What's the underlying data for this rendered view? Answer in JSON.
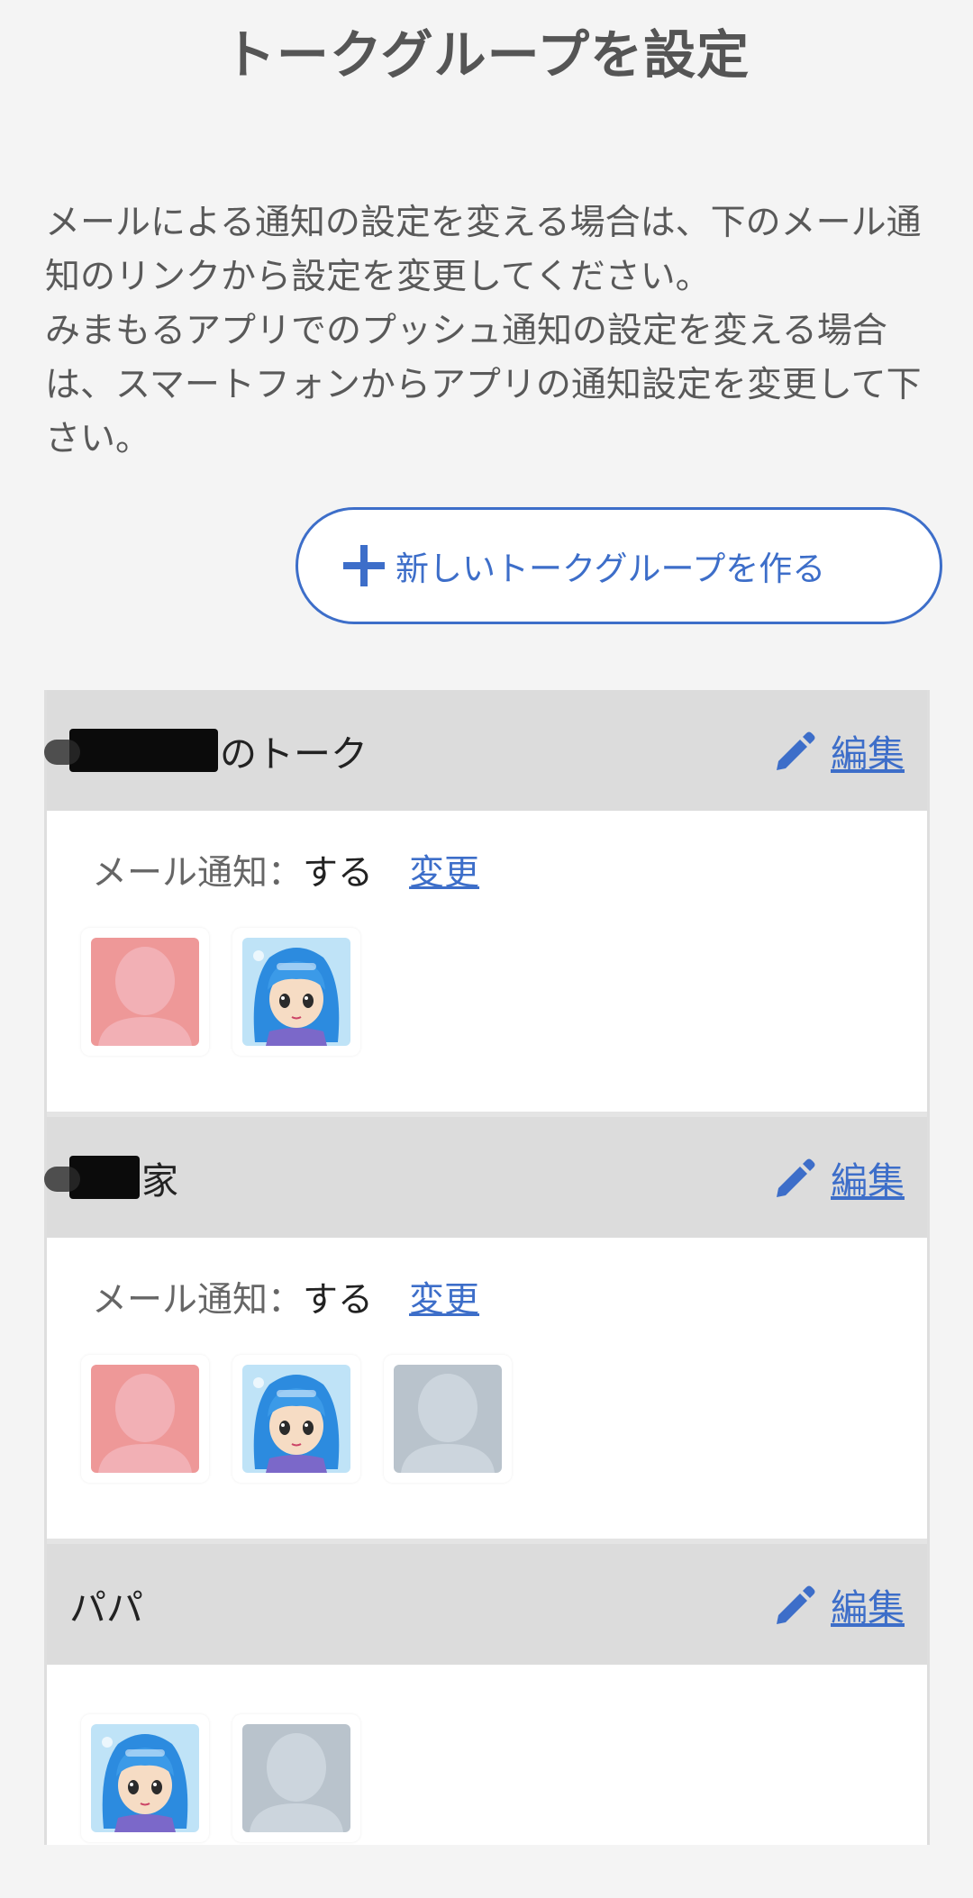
{
  "page": {
    "title": "トークグループを設定"
  },
  "notice": {
    "line1": "メールによる通知の設定を変える場合は、下のメール通知のリンクから設定を変更してください。",
    "line2": "みまもるアプリでのプッシュ通知の設定を変える場合は、スマートフォンからアプリの通知設定を変更して下さい。"
  },
  "new_group_button": {
    "label": "新しいトークグループを作る",
    "icon": "plus-icon"
  },
  "colors": {
    "accent": "#3d6ec9",
    "header_bg": "#dcdcdc",
    "avatar_pink": "#ee9898",
    "avatar_gray": "#b9c3cc"
  },
  "groups": [
    {
      "name_suffix": "のトーク",
      "edit_label": "編集",
      "notify_label": "メール通知：",
      "notify_value": "する",
      "change_label": "変更",
      "members": [
        "pink-default-avatar",
        "anime-girl-avatar"
      ]
    },
    {
      "name_suffix": "家",
      "edit_label": "編集",
      "notify_label": "メール通知：",
      "notify_value": "する",
      "change_label": "変更",
      "members": [
        "pink-default-avatar",
        "anime-girl-avatar",
        "gray-default-avatar"
      ]
    },
    {
      "name": "パパ",
      "edit_label": "編集",
      "members": [
        "anime-girl-avatar",
        "gray-default-avatar"
      ]
    }
  ]
}
